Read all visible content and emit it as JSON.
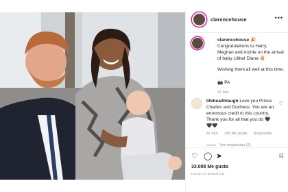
{
  "header": {
    "username": "clarencehouse",
    "more_icon": "more-horizontal-icon"
  },
  "caption": {
    "username": "clarencehouse",
    "text": "Congratulations to Harry, Meghan and Archie on the arrival of baby Lilibet Diana",
    "line2": "Wishing them all well at this time.",
    "flag": "PA",
    "time": "47 min"
  },
  "comment": {
    "username": "lifehealthlaugh",
    "text": "Love you Prince Charles and Duchess. You are an enormous credit to this country. Thank you for all that you do",
    "hearts": "🖤🖤🖤",
    "time": "47 min",
    "likes": "140 Me gusta",
    "reply": "Responder",
    "view_replies": "Ver respuestas (2)"
  },
  "actions": {
    "likes": "33.008 Me gusta",
    "time": "HACE 47 MINUTOS"
  },
  "colors": {
    "accent": "#d6249f",
    "muted": "#8e8e8e",
    "text": "#262626",
    "border": "#efefef"
  }
}
